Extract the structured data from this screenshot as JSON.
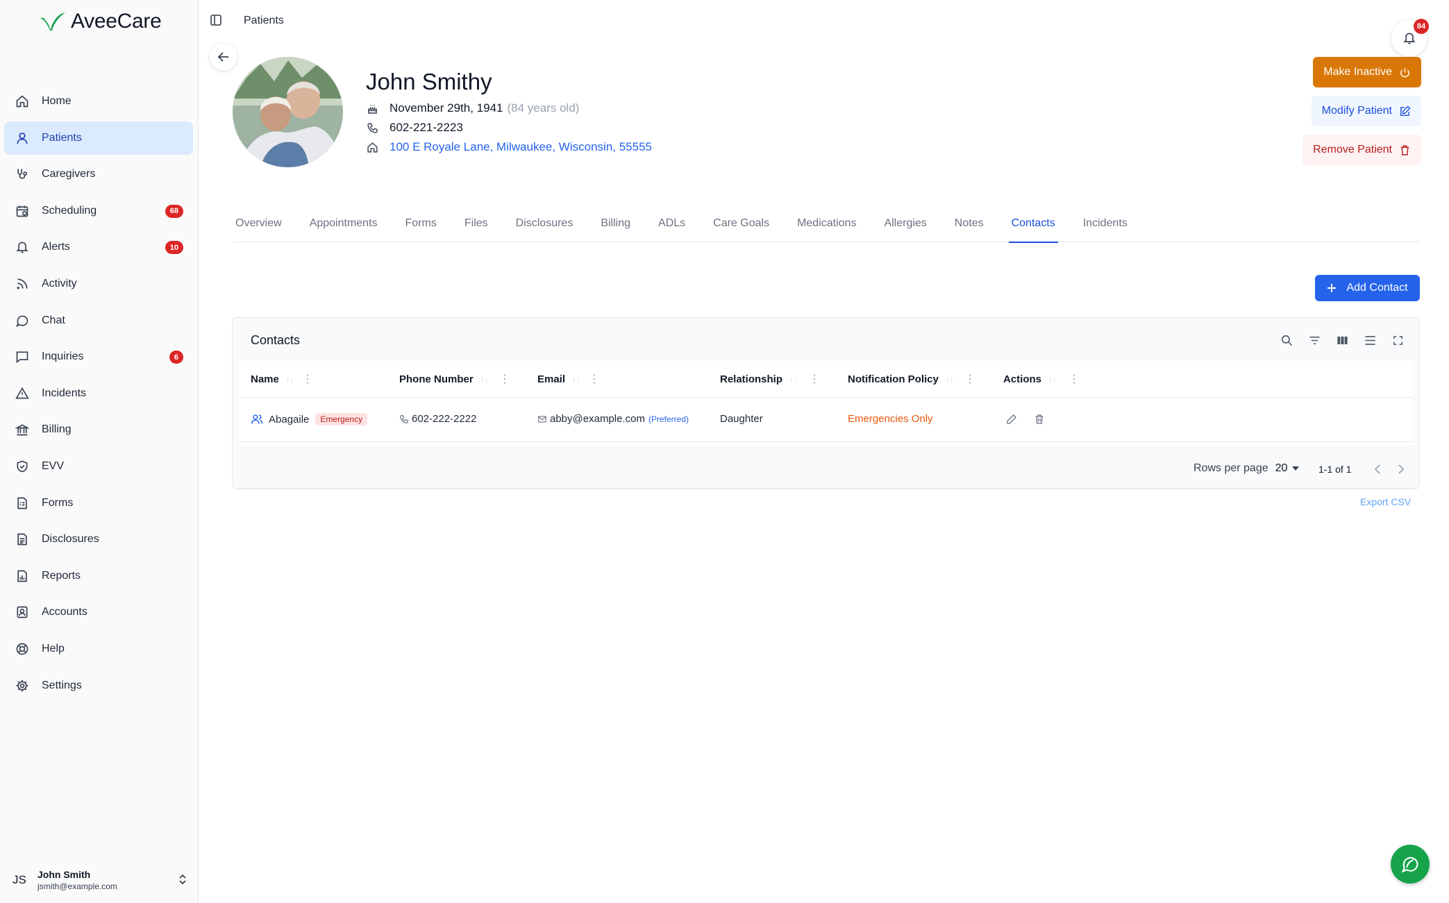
{
  "app": {
    "brand": "AveeCare",
    "brand_color": "#16a34a",
    "accent": "#2563eb"
  },
  "header": {
    "breadcrumb": "Patients",
    "notifications_count": "84"
  },
  "sidebar": {
    "items": [
      {
        "label": "Home",
        "icon": "home-icon"
      },
      {
        "label": "Patients",
        "icon": "user-icon",
        "active": true
      },
      {
        "label": "Caregivers",
        "icon": "stethoscope-icon"
      },
      {
        "label": "Scheduling",
        "icon": "calendar-icon",
        "badge": "68"
      },
      {
        "label": "Alerts",
        "icon": "bell-icon",
        "badge": "10"
      },
      {
        "label": "Activity",
        "icon": "rss-icon"
      },
      {
        "label": "Chat",
        "icon": "chat-bubble-icon"
      },
      {
        "label": "Inquiries",
        "icon": "message-square-icon",
        "badge": "6"
      },
      {
        "label": "Incidents",
        "icon": "warning-triangle-icon"
      },
      {
        "label": "Billing",
        "icon": "bank-icon"
      },
      {
        "label": "EVV",
        "icon": "shield-check-icon"
      },
      {
        "label": "Forms",
        "icon": "form-icon"
      },
      {
        "label": "Disclosures",
        "icon": "document-icon"
      },
      {
        "label": "Reports",
        "icon": "report-icon"
      },
      {
        "label": "Accounts",
        "icon": "contact-card-icon"
      },
      {
        "label": "Help",
        "icon": "lifebuoy-icon"
      },
      {
        "label": "Settings",
        "icon": "gear-icon"
      }
    ],
    "user": {
      "initials": "JS",
      "name": "John Smith",
      "email": "jsmith@example.com"
    }
  },
  "patient": {
    "name": "John Smithy",
    "birthdate": "November 29th, 1941",
    "age": "(84 years old)",
    "phone": "602-221-2223",
    "address": "100 E Royale Lane, Milwaukee, Wisconsin, 55555"
  },
  "actions": {
    "make_inactive": "Make Inactive",
    "modify": "Modify Patient",
    "remove": "Remove Patient"
  },
  "tabs": [
    {
      "label": "Overview"
    },
    {
      "label": "Appointments"
    },
    {
      "label": "Forms"
    },
    {
      "label": "Files"
    },
    {
      "label": "Disclosures"
    },
    {
      "label": "Billing"
    },
    {
      "label": "ADLs"
    },
    {
      "label": "Care Goals"
    },
    {
      "label": "Medications"
    },
    {
      "label": "Allergies"
    },
    {
      "label": "Notes"
    },
    {
      "label": "Contacts",
      "active": true
    },
    {
      "label": "Incidents"
    }
  ],
  "contacts": {
    "add_button": "Add Contact",
    "title": "Contacts",
    "columns": [
      "Name",
      "Phone Number",
      "Email",
      "Relationship",
      "Notification Policy",
      "Actions"
    ],
    "rows": [
      {
        "name": "Abagaile",
        "tag": "Emergency",
        "phone": "602-222-2222",
        "email": "abby@example.com",
        "email_note": "(Preferred)",
        "relationship": "Daughter",
        "policy": "Emergencies Only"
      }
    ],
    "rows_per_page_label": "Rows per page",
    "rows_per_page": "20",
    "page_count": "1-1 of 1",
    "export": "Export CSV"
  }
}
